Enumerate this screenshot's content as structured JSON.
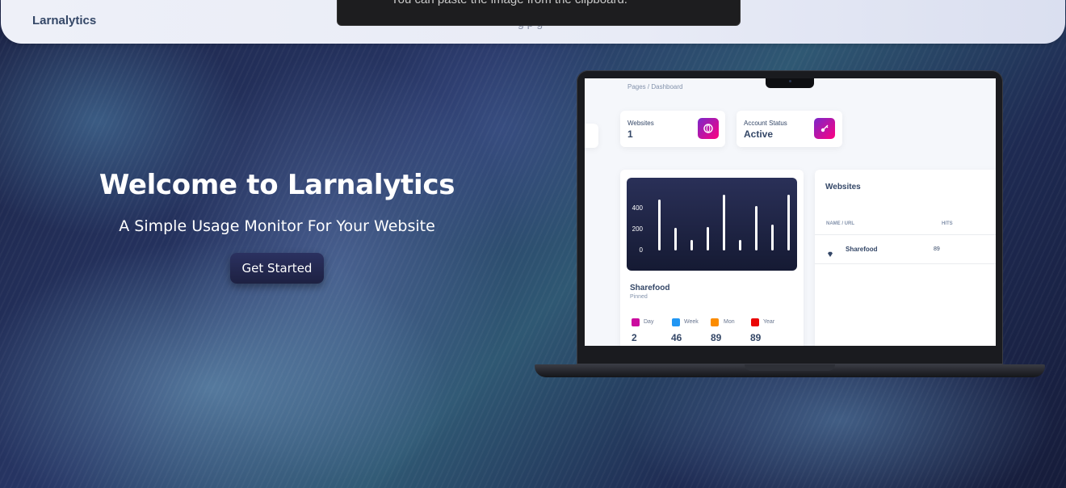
{
  "navbar": {
    "brand": "Larnalytics",
    "faint_text": "g p  g"
  },
  "toast": {
    "message": "You can paste the image from the clipboard."
  },
  "hero": {
    "title": "Welcome to Larnalytics",
    "subtitle": "A Simple Usage Monitor For Your Website",
    "cta_label": "Get Started"
  },
  "dashboard": {
    "breadcrumb": "Pages  /  Dashboard",
    "stats": [
      {
        "label": "Websites",
        "value": "1",
        "icon": "globe-icon"
      },
      {
        "label": "Account Status",
        "value": "Active",
        "icon": "key-icon"
      }
    ],
    "chart": {
      "yticks": [
        "400",
        "200",
        "0"
      ]
    },
    "site_card": {
      "name": "Sharefood",
      "status": "Pinned",
      "periods": [
        {
          "label": "Day",
          "value": "2",
          "color": "#cb0c9f"
        },
        {
          "label": "Week",
          "value": "46",
          "color": "#17c1e8"
        },
        {
          "label": "Mon",
          "value": "89",
          "color": "#f53939"
        },
        {
          "label": "Year",
          "value": "89",
          "color": "#ea0606"
        }
      ]
    },
    "table": {
      "title": "Websites",
      "headers": [
        "NAME / URL",
        "HITS"
      ],
      "rows": [
        {
          "name": "Sharefood",
          "hits": "89"
        }
      ]
    }
  },
  "chart_data": {
    "type": "bar",
    "title": "",
    "xlabel": "",
    "ylabel": "",
    "ylim": [
      0,
      500
    ],
    "yticks": [
      0,
      200,
      400
    ],
    "values": [
      450,
      200,
      90,
      210,
      490,
      95,
      390,
      230,
      490
    ]
  },
  "colors": {
    "accent_gradient_start": "#7928ca",
    "accent_gradient_end": "#ff0080",
    "text_dark": "#344767",
    "cta_bg": "#1d2142"
  }
}
